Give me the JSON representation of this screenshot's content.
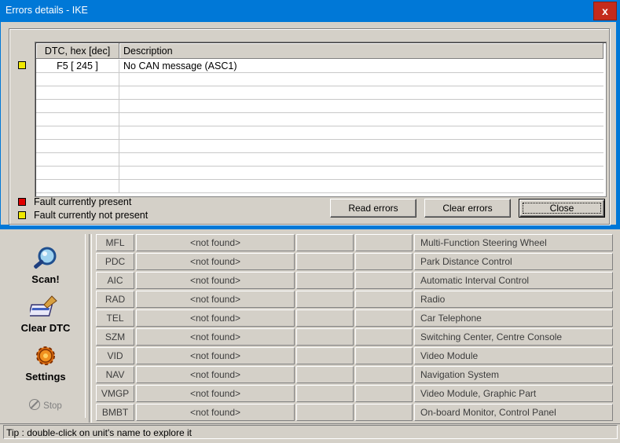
{
  "dialog": {
    "title": "Errors details - IKE",
    "close_glyph": "x",
    "table": {
      "headers": {
        "dtc": "DTC, hex [dec]",
        "description": "Description"
      },
      "rows": [
        {
          "status": "yellow",
          "dtc": "F5 [ 245 ]",
          "description": "No CAN message (ASC1)"
        }
      ]
    },
    "legend": [
      {
        "color": "#e00000",
        "label": "Fault currently present"
      },
      {
        "color": "#f0e800",
        "label": "Fault currently not present"
      }
    ],
    "buttons": {
      "read": "Read errors",
      "clear": "Clear errors",
      "close": "Close"
    }
  },
  "toolbar": {
    "scan": "Scan!",
    "clear_dtc": "Clear DTC",
    "settings": "Settings",
    "stop": "Stop"
  },
  "units": [
    {
      "code": "MFL",
      "version": "<not found>",
      "name": "Multi-Function Steering Wheel"
    },
    {
      "code": "PDC",
      "version": "<not found>",
      "name": "Park Distance Control"
    },
    {
      "code": "AIC",
      "version": "<not found>",
      "name": "Automatic Interval Control"
    },
    {
      "code": "RAD",
      "version": "<not found>",
      "name": "Radio"
    },
    {
      "code": "TEL",
      "version": "<not found>",
      "name": "Car Telephone"
    },
    {
      "code": "SZM",
      "version": "<not found>",
      "name": "Switching Center, Centre Console"
    },
    {
      "code": "VID",
      "version": "<not found>",
      "name": "Video Module"
    },
    {
      "code": "NAV",
      "version": "<not found>",
      "name": "Navigation System"
    },
    {
      "code": "VMGP",
      "version": "<not found>",
      "name": "Video Module, Graphic Part"
    },
    {
      "code": "BMBT",
      "version": "<not found>",
      "name": "On-board Monitor, Control Panel"
    }
  ],
  "status_bar": "Tip : double-click on unit's name to explore it",
  "colors": {
    "titlebar": "#0078d7",
    "close_button": "#c42b1c",
    "face": "#d4d0c8"
  }
}
